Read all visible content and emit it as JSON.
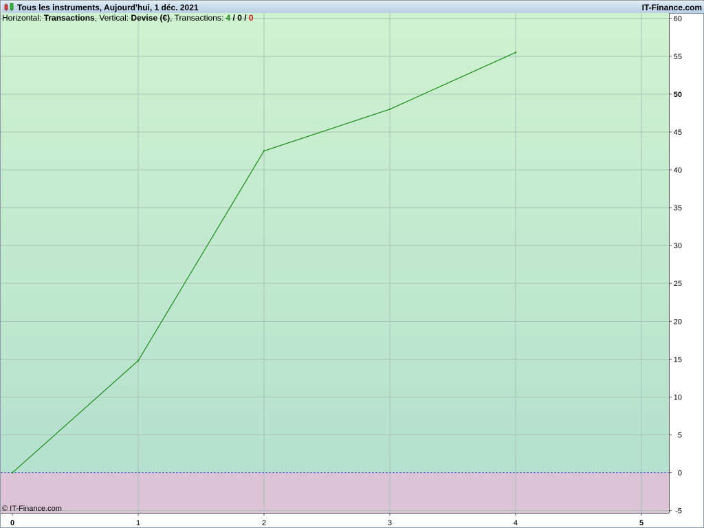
{
  "window": {
    "title": "Tous les instruments, Aujourd'hui, 1 déc. 2021",
    "brand": "IT-Finance.com",
    "copyright": "© IT-Finance.com"
  },
  "info": {
    "horizontal_label": "Horizontal: ",
    "horizontal_value": "Transactions",
    "vertical_label": ", Vertical: ",
    "vertical_value": "Devise (€)",
    "transactions_label": ", Transactions: ",
    "count_total": "4",
    "sep1": " / ",
    "count_neutral": "0",
    "sep2": " / ",
    "count_loss": "0"
  },
  "colors": {
    "positive_top": "#cff2cf",
    "positive_bottom": "#b5e0cf",
    "negative": "#dcc3d6",
    "line": "#1a8c1a",
    "zero_line": "#4a4ad8",
    "grid": "#a9c2b6"
  },
  "chart_data": {
    "type": "line",
    "x": [
      0,
      1,
      2,
      3,
      4
    ],
    "series": [
      {
        "values": [
          0,
          14.8,
          42.5,
          48.0,
          55.5
        ]
      }
    ],
    "xlim": [
      0,
      5.25
    ],
    "ylim": [
      -5.3,
      60.7
    ],
    "x_ticks": [
      "0",
      "1",
      "2",
      "3",
      "4",
      "5"
    ],
    "x_ticks_bold": [
      "0",
      "5"
    ],
    "y_ticks": [
      "60",
      "55",
      "50",
      "45",
      "40",
      "35",
      "30",
      "25",
      "20",
      "15",
      "10",
      "5",
      "0",
      "-5"
    ],
    "y_ticks_bold": [
      "50"
    ],
    "grid": true,
    "zero_line": "dashed"
  }
}
